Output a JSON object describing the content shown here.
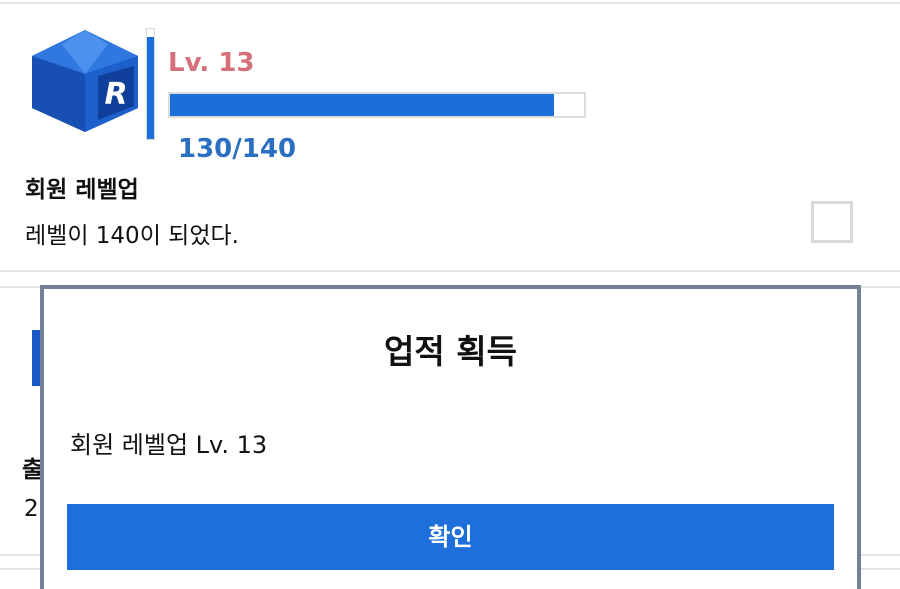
{
  "colors": {
    "accent": "#1e6fd9",
    "level_label": "#d5707a",
    "progress_text": "#2a6fc2",
    "dialog_border": "#747f98"
  },
  "achievement": {
    "icon": "r-cube-logo-icon",
    "level_label": "Lv. 13",
    "progress_current": 130,
    "progress_max": 140,
    "progress_text": "130/140",
    "title": "회원 레벨업",
    "description": "레벨이 140이 되었다.",
    "checkbox_checked": false
  },
  "second_card": {
    "icon": "r-cube-logo-icon",
    "title_fragment": "출",
    "description_fragment": "2"
  },
  "dialog": {
    "title": "업적 획득",
    "message": "회원 레벨업 Lv. 13",
    "confirm_label": "확인"
  }
}
